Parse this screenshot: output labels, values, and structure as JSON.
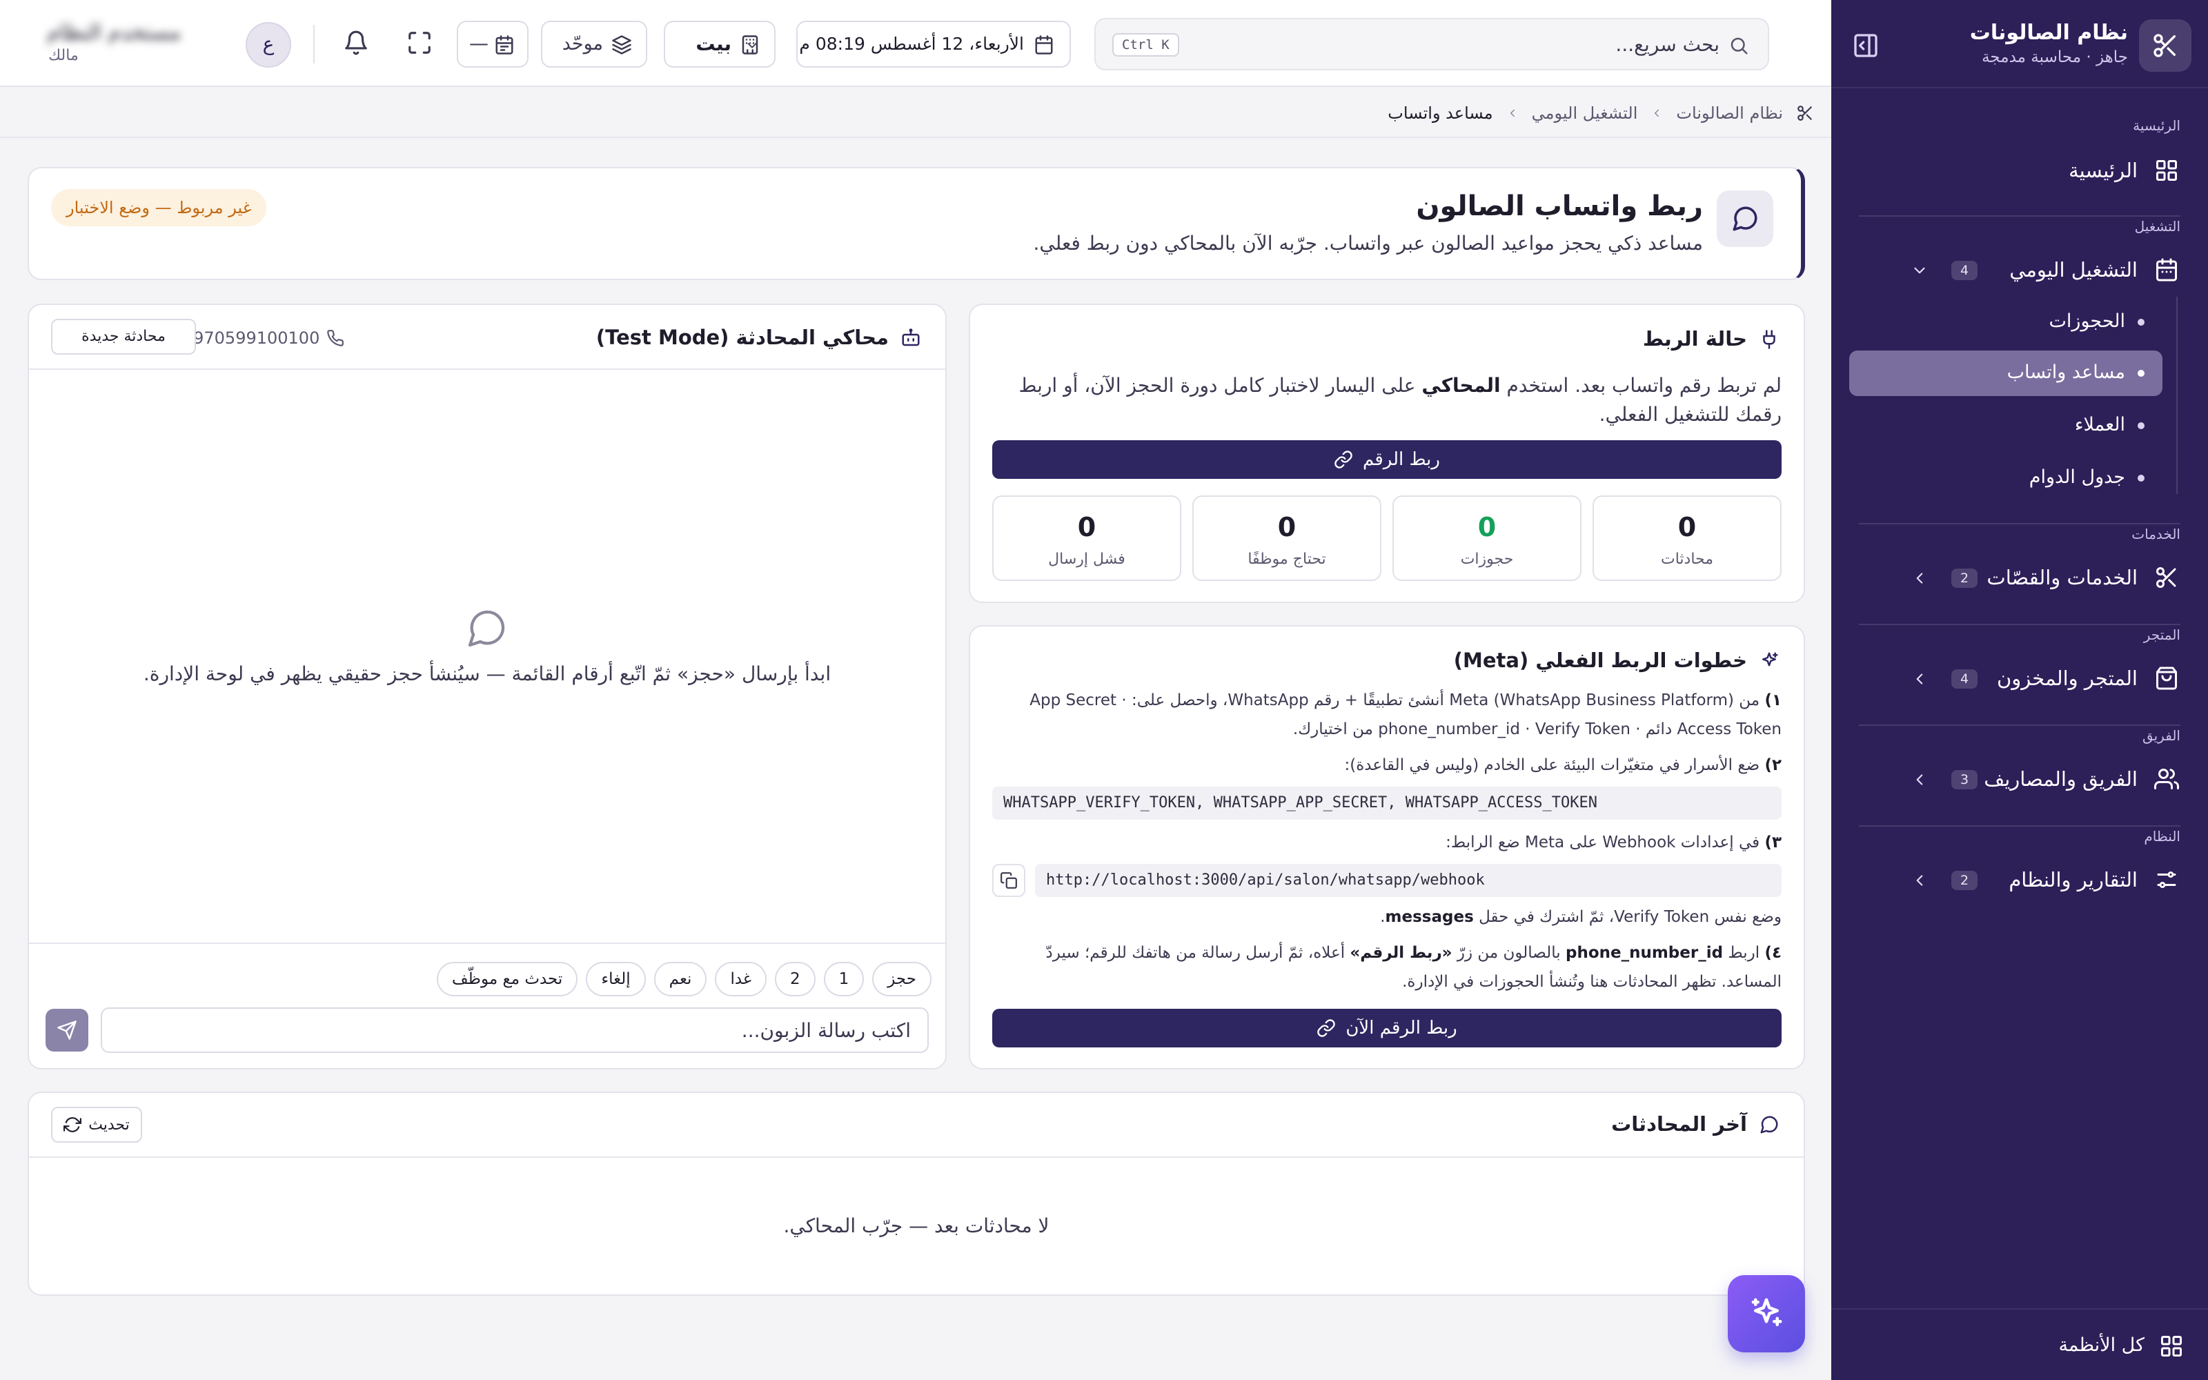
{
  "colors": {
    "sidebar_bg": "#2d1f58",
    "primary": "#2d2660",
    "active_item": "#7a6e9e",
    "warning": "#c26a12",
    "success": "#15a05a",
    "fab": "#7c5cf2"
  },
  "sidebar": {
    "title": "نظام الصالونات",
    "subtitle": "جاهز · محاسبة مدمجة",
    "logo_icon": "scissors-icon",
    "collapse_icon": "sidebar-collapse-icon",
    "sections": [
      {
        "label": "الرئيسية",
        "items": [
          {
            "label": "الرئيسية",
            "icon": "grid-icon"
          }
        ]
      },
      {
        "label": "التشغيل",
        "items": [
          {
            "label": "التشغيل اليومي",
            "icon": "calendar-icon",
            "badge": "4",
            "expanded": true,
            "children": [
              {
                "label": "الحجوزات",
                "active": false
              },
              {
                "label": "مساعد واتساب",
                "active": true
              },
              {
                "label": "العملاء",
                "active": false
              },
              {
                "label": "جدول الدوام",
                "active": false
              }
            ]
          }
        ]
      },
      {
        "label": "الخدمات",
        "items": [
          {
            "label": "الخدمات والقصّات",
            "icon": "scissors-icon",
            "badge": "2"
          }
        ]
      },
      {
        "label": "المتجر",
        "items": [
          {
            "label": "المتجر والمخزون",
            "icon": "shopping-bag-icon",
            "badge": "4"
          }
        ]
      },
      {
        "label": "الفريق",
        "items": [
          {
            "label": "الفريق والمصاريف",
            "icon": "users-icon",
            "badge": "3"
          }
        ]
      },
      {
        "label": "النظام",
        "items": [
          {
            "label": "التقارير والنظام",
            "icon": "sliders-icon",
            "badge": "2"
          }
        ]
      }
    ],
    "footer_label": "كل الأنظمة"
  },
  "topbar": {
    "search_placeholder": "بحث سريع...",
    "search_shortcut": "Ctrl K",
    "datetime": "الأربعاء، 12 أغسطس   08:19 م",
    "branch": "بيت",
    "mode": "موحّد",
    "calendar_value": "—",
    "user_name": "مستخدم النظام",
    "user_role": "مالك",
    "avatar_letter": "ع"
  },
  "breadcrumb": [
    "نظام الصالونات",
    "التشغيل اليومي",
    "مساعد واتساب"
  ],
  "hero": {
    "title": "ربط واتساب الصالون",
    "description": "مساعد ذكي يحجز مواعيد الصالون عبر واتساب. جرّبه الآن بالمحاكي دون ربط فعلي.",
    "badge": "غير مربوط — وضع الاختبار"
  },
  "status_card": {
    "title": "حالة الربط",
    "text_before": "لم تربط رقم واتساب بعد. استخدم ",
    "text_bold": "المحاكي",
    "text_after": " على اليسار لاختبار كامل دورة الحجز الآن، أو اربط رقمك للتشغيل الفعلي.",
    "connect_button": "ربط الرقم",
    "stats": [
      {
        "label": "محادثات",
        "value": "0"
      },
      {
        "label": "حجوزات",
        "value": "0"
      },
      {
        "label": "تحتاج موظفًا",
        "value": "0"
      },
      {
        "label": "فشل إرسال",
        "value": "0"
      }
    ]
  },
  "steps_card": {
    "title": "خطوات الربط الفعلي (Meta)",
    "step1_num": "١)",
    "step1": " من Meta (WhatsApp Business Platform) أنشئ تطبيقًا + رقم WhatsApp، واحصل على: App Secret · Access Token دائم · phone_number_id · Verify Token من اختيارك.",
    "step2_num": "٢)",
    "step2": " ضع الأسرار في متغيّرات البيئة على الخادم (وليس في القاعدة):",
    "env_vars": "WHATSAPP_VERIFY_TOKEN, WHATSAPP_APP_SECRET, WHATSAPP_ACCESS_TOKEN",
    "step3_num": "٣)",
    "step3": " في إعدادات Webhook على Meta ضع الرابط:",
    "webhook_url": "http://localhost:3000/api/salon/whatsapp/webhook",
    "step3_note_before": "وضع نفس Verify Token، ثمّ اشترك في حقل ",
    "step3_note_bold": "messages",
    "step3_note_after": ".",
    "step4_num": "٤)",
    "step4_a": " اربط ",
    "step4_b": "phone_number_id",
    "step4_c": " بالصالون من زرّ ",
    "step4_d": "«ربط الرقم»",
    "step4_e": " أعلاه، ثمّ أرسل رسالة من هاتفك للرقم؛ سيردّ المساعد. تظهر المحادثات هنا وتُنشأ الحجوزات في الإدارة.",
    "connect_now_button": "ربط الرقم الآن"
  },
  "simulator": {
    "title": "محاكي المحادثة (Test Mode)",
    "phone": "+970599100100",
    "new_chat_button": "محادثة جديدة",
    "empty_text": "ابدأ بإرسال «حجز» ثمّ اتّبع أرقام القائمة — سيُنشأ حجز حقيقي يظهر في لوحة الإدارة.",
    "quick_replies": [
      "حجز",
      "1",
      "2",
      "غدا",
      "نعم",
      "إلغاء",
      "تحدث مع موظّف"
    ],
    "input_placeholder": "اكتب رسالة الزبون..."
  },
  "recent": {
    "title": "آخر المحادثات",
    "refresh_button": "تحديث",
    "empty_text": "لا محادثات بعد — جرّب المحاكي."
  }
}
